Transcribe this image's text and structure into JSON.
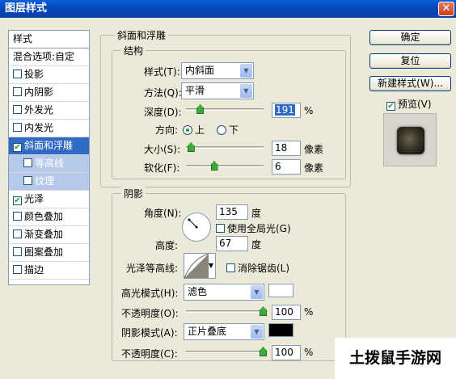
{
  "window": {
    "title": "图层样式",
    "close_icon": "close-icon"
  },
  "sidebar": {
    "header": "样式",
    "items": [
      {
        "label": "混合选项:自定",
        "checkbox": false,
        "checked": false,
        "state": "normal"
      },
      {
        "label": "投影",
        "checkbox": true,
        "checked": false,
        "state": "normal"
      },
      {
        "label": "内阴影",
        "checkbox": true,
        "checked": false,
        "state": "normal"
      },
      {
        "label": "外发光",
        "checkbox": true,
        "checked": false,
        "state": "normal"
      },
      {
        "label": "内发光",
        "checkbox": true,
        "checked": false,
        "state": "normal"
      },
      {
        "label": "斜面和浮雕",
        "checkbox": true,
        "checked": true,
        "state": "selected"
      },
      {
        "label": "等高线",
        "checkbox": true,
        "checked": false,
        "state": "sub"
      },
      {
        "label": "纹理",
        "checkbox": true,
        "checked": false,
        "state": "sub"
      },
      {
        "label": "光泽",
        "checkbox": true,
        "checked": true,
        "state": "normal"
      },
      {
        "label": "颜色叠加",
        "checkbox": true,
        "checked": false,
        "state": "normal"
      },
      {
        "label": "渐变叠加",
        "checkbox": true,
        "checked": false,
        "state": "normal"
      },
      {
        "label": "图案叠加",
        "checkbox": true,
        "checked": false,
        "state": "normal"
      },
      {
        "label": "描边",
        "checkbox": true,
        "checked": false,
        "state": "normal"
      }
    ]
  },
  "bevel": {
    "section_title": "斜面和浮雕",
    "structure_title": "结构",
    "style_label": "样式(T):",
    "style_value": "内斜面",
    "technique_label": "方法(Q):",
    "technique_value": "平滑",
    "depth_label": "深度(D):",
    "depth_value": "191",
    "depth_unit": "%",
    "depth_slider_fraction": 0.19,
    "direction_label": "方向:",
    "direction_up": "上",
    "direction_down": "下",
    "direction_selected": "up",
    "size_label": "大小(S):",
    "size_value": "18",
    "size_unit": "像素",
    "size_slider_fraction": 0.07,
    "soften_label": "软化(F):",
    "soften_value": "6",
    "soften_unit": "像素",
    "soften_slider_fraction": 0.37
  },
  "shading": {
    "title": "阴影",
    "angle_label": "角度(N):",
    "angle_value": "135",
    "angle_unit": "度",
    "global_light_label": "使用全局光(G)",
    "global_light_checked": false,
    "altitude_label": "高度:",
    "altitude_value": "67",
    "altitude_unit": "度",
    "gloss_contour_label": "光泽等高线:",
    "anti_alias_label": "消除锯齿(L)",
    "anti_alias_checked": false,
    "highlight_mode_label": "高光模式(H):",
    "highlight_mode_value": "滤色",
    "highlight_color": "#ffffff",
    "highlight_opacity_label": "不透明度(O):",
    "highlight_opacity_value": "100",
    "highlight_opacity_fraction": 1.0,
    "opacity_unit": "%",
    "shadow_mode_label": "阴影模式(A):",
    "shadow_mode_value": "正片叠底",
    "shadow_color": "#000000",
    "shadow_opacity_label": "不透明度(C):",
    "shadow_opacity_value": "100",
    "shadow_opacity_fraction": 1.0
  },
  "buttons": {
    "ok": "确定",
    "reset": "复位",
    "new_style": "新建样式(W)...",
    "preview_label": "预览(V)",
    "preview_checked": true
  },
  "watermark": "土拨鼠手游网",
  "colors": {
    "title_bar": "#0a3fa8",
    "selection": "#316ac5",
    "dialog_bg": "#ece9d8",
    "slider_thumb": "#3cab3c"
  }
}
